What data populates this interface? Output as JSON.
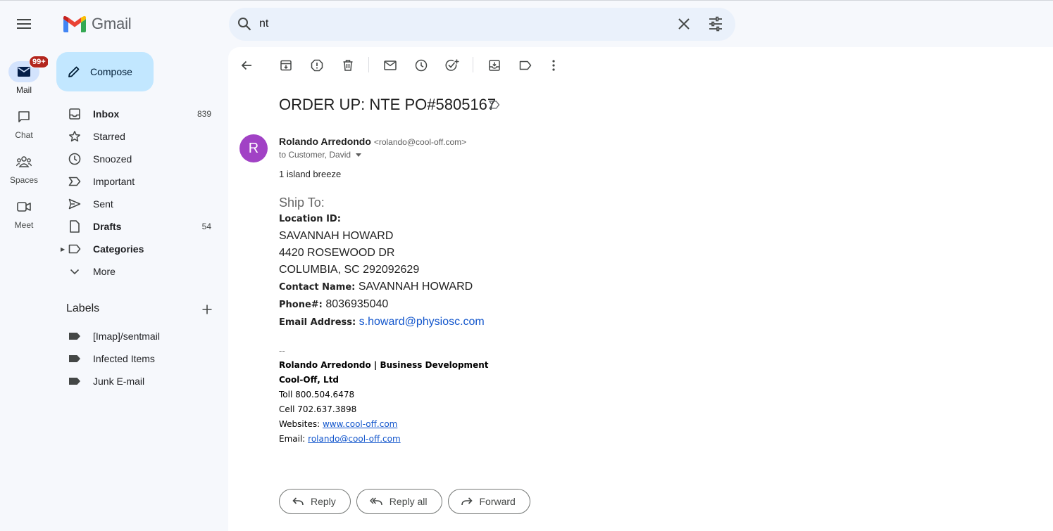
{
  "app": {
    "name": "Gmail"
  },
  "rail": {
    "items": [
      {
        "label": "Mail",
        "icon": "mail-icon",
        "badge": "99+"
      },
      {
        "label": "Chat",
        "icon": "chat-icon"
      },
      {
        "label": "Spaces",
        "icon": "spaces-icon"
      },
      {
        "label": "Meet",
        "icon": "meet-icon"
      }
    ]
  },
  "compose": {
    "label": "Compose"
  },
  "nav": {
    "items": [
      {
        "label": "Inbox",
        "count": "839",
        "icon": "inbox-icon"
      },
      {
        "label": "Starred",
        "count": "",
        "icon": "star-icon"
      },
      {
        "label": "Snoozed",
        "count": "",
        "icon": "clock-icon"
      },
      {
        "label": "Important",
        "count": "",
        "icon": "important-icon"
      },
      {
        "label": "Sent",
        "count": "",
        "icon": "send-icon"
      },
      {
        "label": "Drafts",
        "count": "54",
        "icon": "draft-icon"
      },
      {
        "label": "Categories",
        "count": "",
        "icon": "label-icon"
      },
      {
        "label": "More",
        "count": "",
        "icon": "chevron-down-icon"
      }
    ]
  },
  "labels": {
    "header": "Labels",
    "items": [
      {
        "label": "[Imap]/sentmail"
      },
      {
        "label": "Infected Items"
      },
      {
        "label": "Junk E-mail"
      }
    ]
  },
  "search": {
    "value": "nt"
  },
  "email": {
    "subject": "ORDER UP: NTE PO#5805167",
    "sender_initial": "R",
    "sender_name": "Rolando Arredondo",
    "sender_email": "<rolando@cool-off.com>",
    "to_line": "to Customer, David",
    "body_line1": "1 island breeze",
    "ship_to": "Ship To:",
    "location_label": "Location ID:",
    "address_name": "SAVANNAH HOWARD",
    "address_street": "4420 ROSEWOOD DR",
    "address_city": "COLUMBIA, SC 292092629",
    "contact_label": "Contact Name:",
    "contact_value": "SAVANNAH HOWARD",
    "phone_label": "Phone#:",
    "phone_value": "8036935040",
    "email_label": "Email Address:",
    "email_value": "s.howard@physiosc.com",
    "sig_dash": "--",
    "sig_title": "Rolando Arredondo | Business Development",
    "sig_company": "Cool-Off, Ltd",
    "sig_toll": "Toll 800.504.6478",
    "sig_cell": "Cell 702.637.3898",
    "sig_website_label": "Websites:",
    "sig_website": "www.cool-off.com",
    "sig_email_label": "Email:",
    "sig_email": "rolando@cool-off.com"
  },
  "actions": {
    "reply": "Reply",
    "reply_all": "Reply all",
    "forward": "Forward"
  },
  "colors": {
    "avatar": "#a142c5",
    "compose_bg": "#c2e7ff",
    "badge": "#b3261e",
    "link": "#1155cc"
  }
}
